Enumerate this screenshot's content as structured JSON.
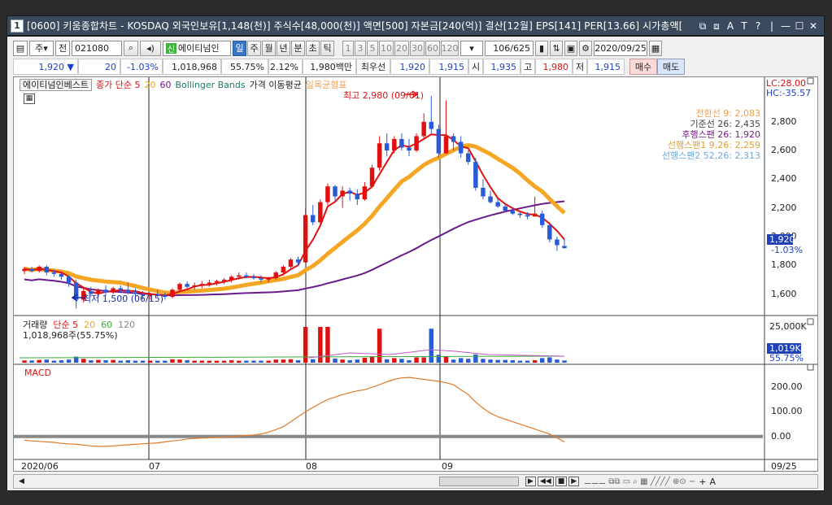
{
  "window": {
    "icon_text": "1",
    "title": "[0600] 키움종합차트 - KOSDAQ 외국인보유[1,148(천)] 주식수[48,000(천)] 액면[500] 자본금[240(억)] 결산[12월] EPS[141] PER[13.66] 시가총액[",
    "controls": [
      "⧉",
      "⧈",
      "A",
      "T",
      "?",
      "|",
      "—",
      "☐",
      "✕"
    ]
  },
  "toolbar": {
    "period_opts": [
      "주",
      "전"
    ],
    "code": "021080",
    "stock_name": "에이티넘인",
    "new_badge": "신",
    "intervals": [
      "일",
      "주",
      "월",
      "년",
      "분",
      "초",
      "틱"
    ],
    "active_interval": "일",
    "minutes": [
      "1",
      "3",
      "5",
      "10",
      "20",
      "30",
      "60",
      "120"
    ],
    "count": "106",
    "total": "/625",
    "date": "2020/09/25"
  },
  "quote": {
    "price": "1,920",
    "arrow": "▼",
    "change": "20",
    "change_pct": "-1.03%",
    "volume": "1,018,968",
    "vol_ratio": "55.75%",
    "turnover": "2.12%",
    "amount": "1,980백만",
    "priority_label": "최우선",
    "bid1": "1,920",
    "bid2": "1,915",
    "open_label": "시",
    "open": "1,935",
    "high_label": "고",
    "high": "1,980",
    "low_label": "저",
    "low": "1,915",
    "buy": "매수",
    "sell": "매도"
  },
  "legend": {
    "name": "에이티넘인베스트",
    "ma_label": "종가 단순 5",
    "ma20": "20",
    "ma60": "60",
    "bollinger": "Bollinger Bands",
    "price_ma": "가격 이동평균",
    "ichimoku": "일목균형표"
  },
  "ichimoku_legend": [
    {
      "text": "전환선 9: 2,083",
      "color": "#f0a050"
    },
    {
      "text": "기준선 26: 2,435",
      "color": "#444444"
    },
    {
      "text": "후행스팬 26: 1,920",
      "color": "#7a1a8a"
    },
    {
      "text": "선행스팬1 9,26: 2,259",
      "color": "#e0a030"
    },
    {
      "text": "선행스팬2 52,26: 2,313",
      "color": "#6fa8dc"
    }
  ],
  "price_axis": {
    "lc": "LC:28.00",
    "hc": "HC:-35.57",
    "ticks": [
      "2,800",
      "2,600",
      "2,400",
      "2,200",
      "2,000",
      "1,800",
      "1,600"
    ],
    "current": "1,920",
    "current_pct": "-1.03%"
  },
  "annotations": {
    "max": "최고 2,980 (09/01)",
    "min": "최저 1,500 (06/15)"
  },
  "volume_pane": {
    "label": "거래량",
    "ma_label": "단순 5",
    "ma20": "20",
    "ma60": "60",
    "ma120": "120",
    "value": "1,018,968주(55.75%)",
    "axis_top": "25,000K",
    "current": "1,019K",
    "current_pct": "55.75%"
  },
  "macd_pane": {
    "label": "MACD",
    "ticks": [
      "200.00",
      "100.00",
      "0.00"
    ]
  },
  "date_axis": [
    "2020/06",
    "07",
    "08",
    "09",
    "09/25"
  ],
  "colors": {
    "up": "#e01010",
    "down": "#2a5bd7",
    "ma5": "#e01010",
    "ma20": "#f5a623",
    "ma60": "#6a1a8a",
    "macd": "#e07a2a"
  },
  "chart_data": {
    "type": "candlestick",
    "period": "daily",
    "price_range": [
      1500,
      2980
    ],
    "max": {
      "price": 2980,
      "date": "09/01"
    },
    "min": {
      "price": 1500,
      "date": "06/15"
    },
    "last": {
      "price": 1920,
      "change": -20,
      "change_pct": -1.03
    },
    "candles": [
      [
        1760,
        1790,
        1740,
        1775
      ],
      [
        1775,
        1790,
        1750,
        1760
      ],
      [
        1760,
        1800,
        1750,
        1790
      ],
      [
        1790,
        1800,
        1730,
        1750
      ],
      [
        1750,
        1770,
        1720,
        1740
      ],
      [
        1740,
        1750,
        1700,
        1720
      ],
      [
        1720,
        1730,
        1650,
        1680
      ],
      [
        1680,
        1700,
        1500,
        1560
      ],
      [
        1560,
        1640,
        1540,
        1620
      ],
      [
        1620,
        1650,
        1580,
        1600
      ],
      [
        1600,
        1640,
        1580,
        1630
      ],
      [
        1630,
        1660,
        1590,
        1610
      ],
      [
        1610,
        1650,
        1600,
        1640
      ],
      [
        1640,
        1660,
        1610,
        1630
      ],
      [
        1630,
        1680,
        1600,
        1610
      ],
      [
        1610,
        1640,
        1580,
        1600
      ],
      [
        1600,
        1620,
        1560,
        1590
      ],
      [
        1590,
        1610,
        1560,
        1600
      ],
      [
        1600,
        1630,
        1580,
        1590
      ],
      [
        1590,
        1610,
        1560,
        1580
      ],
      [
        1580,
        1640,
        1570,
        1630
      ],
      [
        1630,
        1680,
        1620,
        1670
      ],
      [
        1670,
        1690,
        1640,
        1650
      ],
      [
        1650,
        1680,
        1630,
        1660
      ],
      [
        1660,
        1690,
        1640,
        1670
      ],
      [
        1670,
        1700,
        1650,
        1680
      ],
      [
        1680,
        1700,
        1660,
        1690
      ],
      [
        1690,
        1710,
        1670,
        1700
      ],
      [
        1700,
        1730,
        1680,
        1720
      ],
      [
        1720,
        1750,
        1700,
        1730
      ],
      [
        1730,
        1750,
        1710,
        1720
      ],
      [
        1720,
        1740,
        1700,
        1710
      ],
      [
        1710,
        1730,
        1680,
        1700
      ],
      [
        1700,
        1720,
        1680,
        1710
      ],
      [
        1710,
        1760,
        1700,
        1750
      ],
      [
        1750,
        1800,
        1730,
        1790
      ],
      [
        1790,
        1850,
        1780,
        1840
      ],
      [
        1840,
        1860,
        1800,
        1820
      ],
      [
        1820,
        2200,
        1820,
        2150
      ],
      [
        2150,
        2220,
        2080,
        2100
      ],
      [
        2100,
        2260,
        2090,
        2240
      ],
      [
        2240,
        2370,
        2220,
        2350
      ],
      [
        2350,
        2360,
        2250,
        2280
      ],
      [
        2280,
        2350,
        2200,
        2320
      ],
      [
        2320,
        2340,
        2250,
        2300
      ],
      [
        2300,
        2330,
        2220,
        2260
      ],
      [
        2260,
        2380,
        2250,
        2350
      ],
      [
        2350,
        2500,
        2340,
        2480
      ],
      [
        2480,
        2700,
        2460,
        2650
      ],
      [
        2650,
        2720,
        2560,
        2600
      ],
      [
        2600,
        2700,
        2580,
        2680
      ],
      [
        2680,
        2720,
        2600,
        2620
      ],
      [
        2620,
        2680,
        2560,
        2600
      ],
      [
        2600,
        2720,
        2590,
        2700
      ],
      [
        2700,
        2860,
        2680,
        2800
      ],
      [
        2800,
        2980,
        2720,
        2750
      ],
      [
        2750,
        2780,
        2550,
        2580
      ],
      [
        2580,
        2950,
        2580,
        2700
      ],
      [
        2700,
        2720,
        2600,
        2660
      ],
      [
        2660,
        2700,
        2550,
        2580
      ],
      [
        2580,
        2600,
        2500,
        2520
      ],
      [
        2520,
        2550,
        2320,
        2340
      ],
      [
        2340,
        2400,
        2260,
        2280
      ],
      [
        2280,
        2320,
        2230,
        2240
      ],
      [
        2240,
        2260,
        2200,
        2210
      ],
      [
        2210,
        2230,
        2170,
        2180
      ],
      [
        2180,
        2200,
        2150,
        2160
      ],
      [
        2160,
        2180,
        2130,
        2150
      ],
      [
        2150,
        2170,
        2120,
        2140
      ],
      [
        2140,
        2280,
        2140,
        2160
      ],
      [
        2160,
        2180,
        2060,
        2080
      ],
      [
        2080,
        2100,
        1960,
        1980
      ],
      [
        1980,
        2000,
        1900,
        1940
      ],
      [
        1935,
        1980,
        1915,
        1920
      ]
    ]
  }
}
